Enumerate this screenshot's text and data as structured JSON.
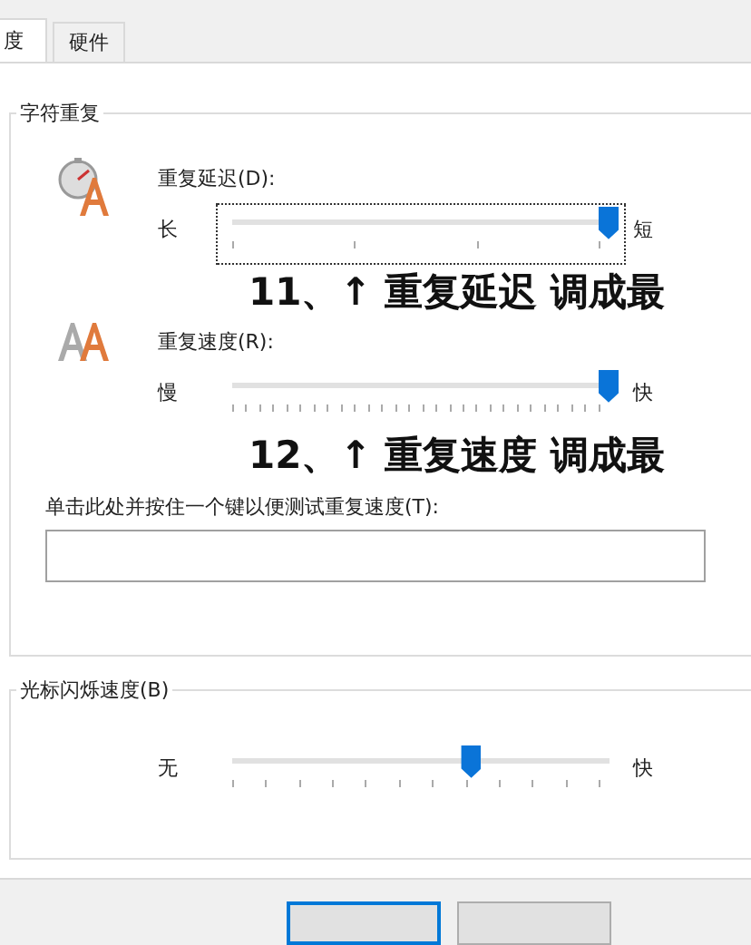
{
  "tabs": [
    {
      "label": "度",
      "selected": true
    },
    {
      "label": "硬件",
      "selected": false
    }
  ],
  "character_repeat": {
    "title": "字符重复",
    "settings": [
      {
        "label": "重复延迟(D):",
        "min_label": "长",
        "max_label": "短",
        "kind": "coarse",
        "level": 1,
        "focused": true,
        "annotation": "11、↑  重复延迟 调成最"
      },
      {
        "label": "重复速度(R):",
        "min_label": "慢",
        "max_label": "快",
        "kind": "fine",
        "level": 1,
        "focused": false,
        "annotation": "12、↑  重复速度 调成最"
      }
    ],
    "test_label": "单击此处并按住一个键以便测试重复速度(T):"
  },
  "cursor_blink": {
    "title": "光标闪烁速度(B)",
    "min_label": "无",
    "max_label": "快",
    "kind": "medium",
    "level": 0.636,
    "focused": false
  },
  "buttons": [
    {
      "kind": "default"
    },
    {
      "kind": "normal"
    }
  ]
}
